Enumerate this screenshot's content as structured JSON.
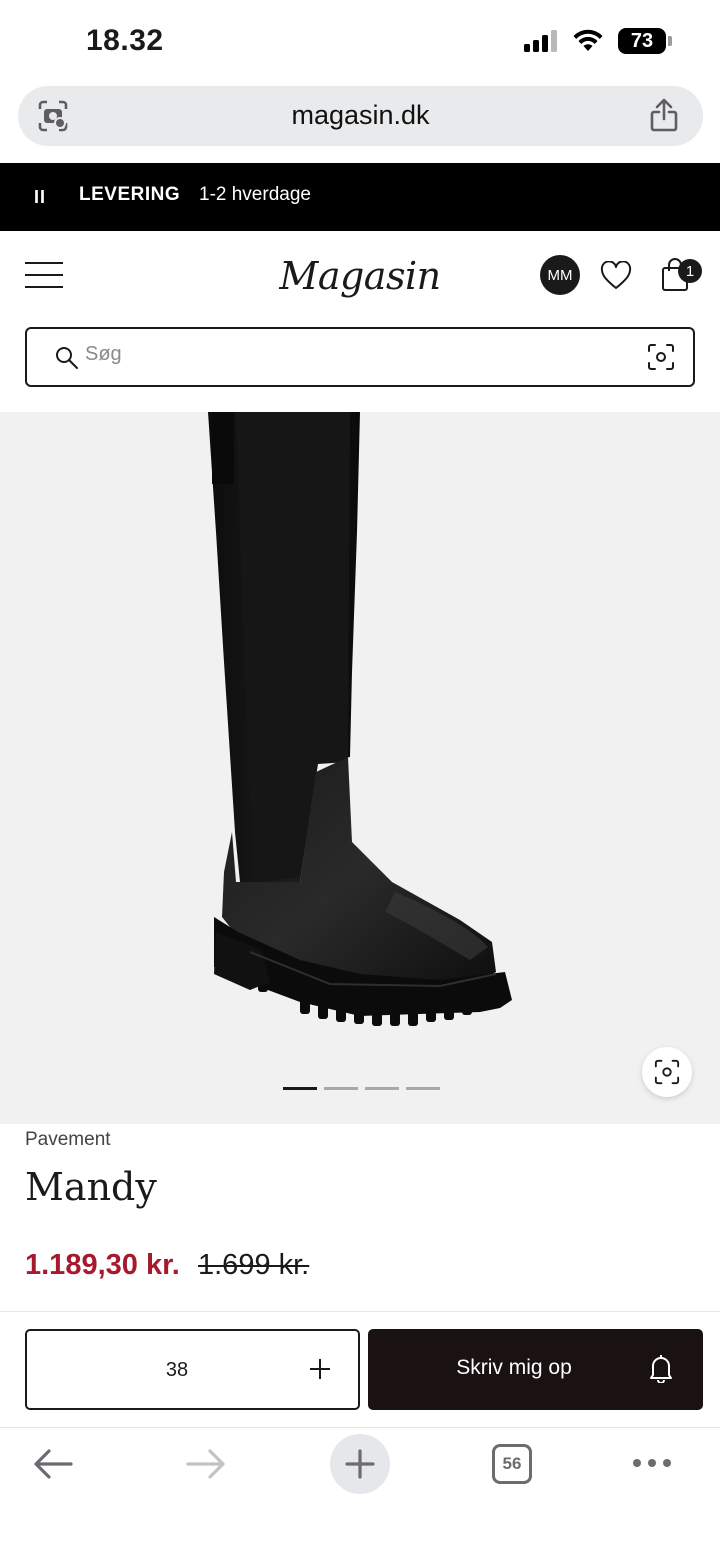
{
  "status_bar": {
    "time": "18.32",
    "battery": "73"
  },
  "browser": {
    "url": "magasin.dk",
    "tabs_count": "56"
  },
  "promo": {
    "pause_icon": "II",
    "label": "LEVERING",
    "text": "1-2 hverdage"
  },
  "header": {
    "logo": "Magasin",
    "avatar_initials": "MM",
    "cart_count": "1"
  },
  "search": {
    "placeholder": "Søg"
  },
  "product": {
    "brand": "Pavement",
    "name": "Mandy",
    "price_sale": "1.189,30 kr.",
    "price_original": "1.699 kr.",
    "image_count": 4,
    "active_image": 1
  },
  "actions": {
    "size": "38",
    "notify_label": "Skriv mig op"
  },
  "icons": {
    "camera_search": "camera-search-icon",
    "share": "share-icon",
    "menu": "hamburger-menu-icon",
    "wishlist": "heart-icon",
    "cart": "shopping-bag-icon",
    "search": "magnifier-icon",
    "scan": "visual-search-icon",
    "add": "plus-icon",
    "notify": "bell-icon"
  },
  "colors": {
    "sale": "#a6192e",
    "dark": "#1a1a1a",
    "image_bg": "#f1f1f1"
  }
}
